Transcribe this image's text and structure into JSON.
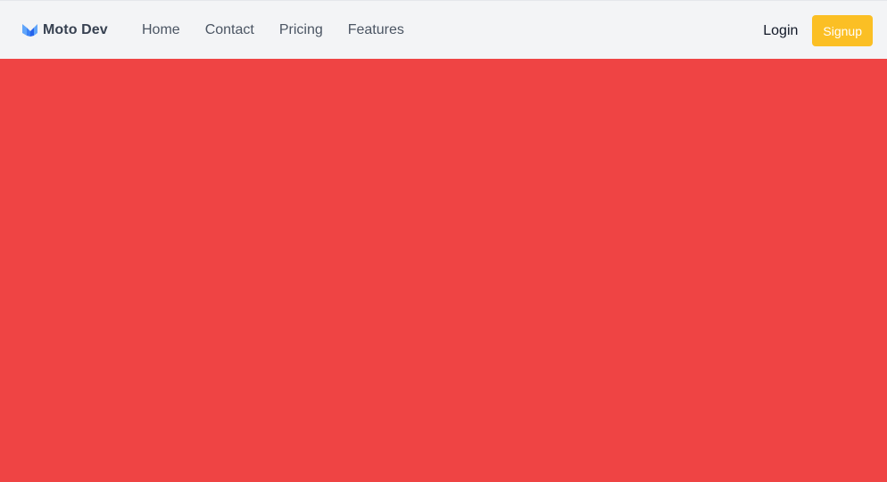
{
  "navbar": {
    "brand_name": "Moto Dev",
    "links": [
      {
        "label": "Home"
      },
      {
        "label": "Contact"
      },
      {
        "label": "Pricing"
      },
      {
        "label": "Features"
      }
    ],
    "login_label": "Login",
    "signup_label": "Signup"
  },
  "colors": {
    "navbar_bg": "#f3f4f6",
    "brand_icon": "#3b82f6",
    "signup_bg": "#fbbf24",
    "hero_bg": "#ef4444"
  }
}
